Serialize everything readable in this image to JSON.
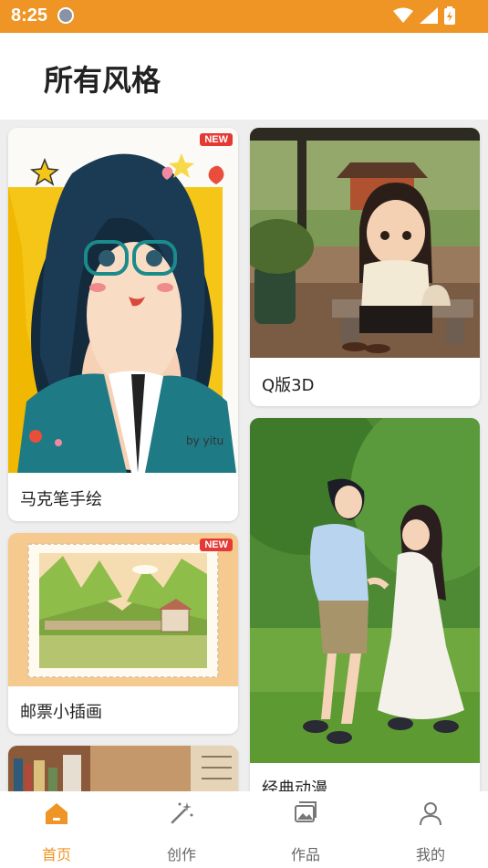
{
  "status_bar": {
    "time": "8:25"
  },
  "header": {
    "title": "所有风格"
  },
  "styles": [
    {
      "label": "马克笔手绘",
      "badge": "NEW"
    },
    {
      "label": "Q版3D"
    },
    {
      "label": "邮票小插画",
      "badge": "NEW"
    },
    {
      "label": "经典动漫"
    }
  ],
  "artwork": {
    "signature": "by yitu"
  },
  "nav": [
    {
      "label": "首页",
      "icon": "home-icon",
      "active": true
    },
    {
      "label": "创作",
      "icon": "magic-wand-icon"
    },
    {
      "label": "作品",
      "icon": "gallery-icon"
    },
    {
      "label": "我的",
      "icon": "user-icon"
    }
  ],
  "colors": {
    "accent": "#ef9526",
    "badge": "#e53935"
  }
}
